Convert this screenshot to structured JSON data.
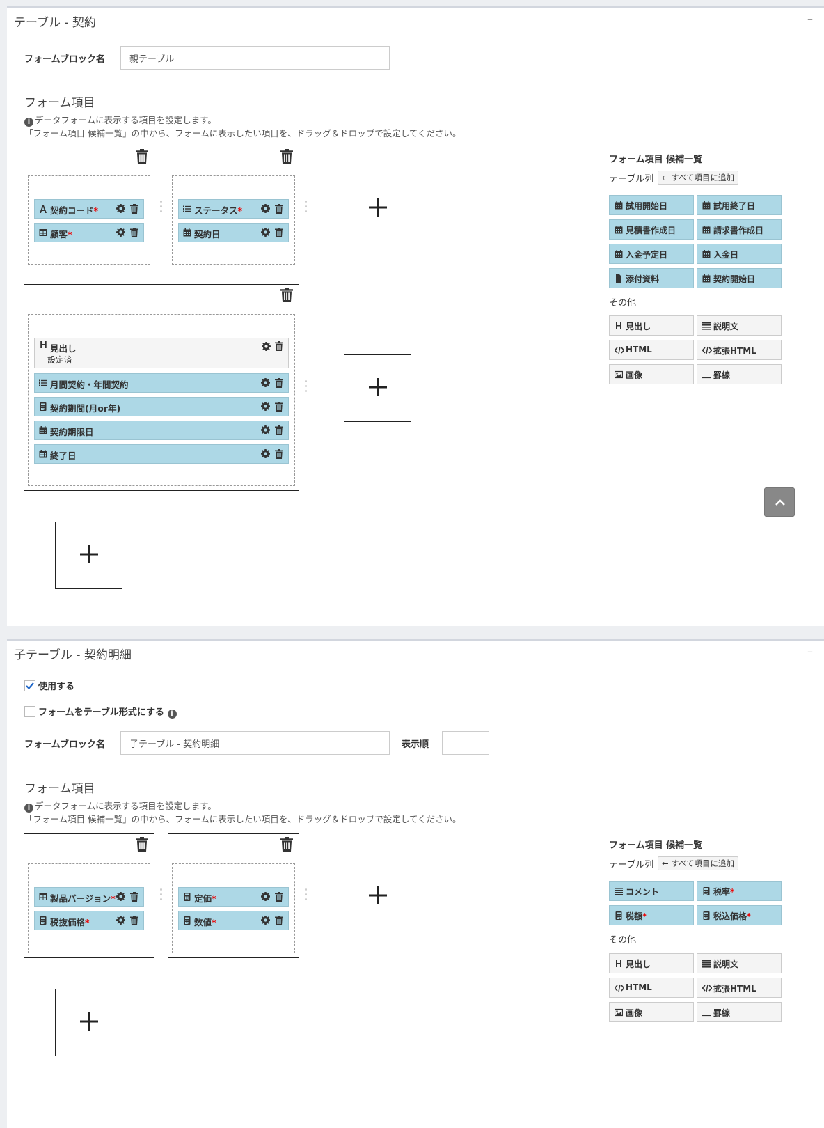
{
  "panel1": {
    "title": "テーブル - 契約",
    "collapse": "–",
    "block_name_label": "フォームブロック名",
    "block_name_value": "親テーブル",
    "section_title": "フォーム項目",
    "help_line1": "データフォームに表示する項目を設定します。",
    "help_line2": "「フォーム項目 候補一覧」の中から、フォームに表示したい項目を、ドラッグ＆ドロップで設定してください。",
    "blockA_items": [
      {
        "label": "契約コード",
        "req": "*",
        "icon": "text-icon"
      },
      {
        "label": "顧客",
        "req": "*",
        "icon": "table-icon"
      }
    ],
    "blockB_items": [
      {
        "label": "ステータス",
        "req": "*",
        "icon": "list-icon"
      },
      {
        "label": "契約日",
        "req": "",
        "icon": "calendar-icon"
      }
    ],
    "blockC_heading": {
      "label": "見出し",
      "sub": "設定済",
      "icon": "heading-icon"
    },
    "blockC_items": [
      {
        "label": "月間契約・年間契約",
        "req": "",
        "icon": "list-icon"
      },
      {
        "label": "契約期間(月or年)",
        "req": "",
        "icon": "calculator-icon"
      },
      {
        "label": "契約期限日",
        "req": "",
        "icon": "calendar-icon"
      },
      {
        "label": "終了日",
        "req": "",
        "icon": "calendar-icon"
      }
    ],
    "candidates_title": "フォーム項目 候補一覧",
    "table_col_label": "テーブル列",
    "add_all_label": "すべて項目に追加",
    "table_candidates": [
      {
        "label": "試用開始日",
        "req": "",
        "icon": "calendar-icon"
      },
      {
        "label": "試用終了日",
        "req": "",
        "icon": "calendar-icon"
      },
      {
        "label": "見積書作成日",
        "req": "",
        "icon": "calendar-icon"
      },
      {
        "label": "請求書作成日",
        "req": "",
        "icon": "calendar-icon"
      },
      {
        "label": "入金予定日",
        "req": "",
        "icon": "calendar-icon"
      },
      {
        "label": "入金日",
        "req": "",
        "icon": "calendar-icon"
      },
      {
        "label": "添付資料",
        "req": "",
        "icon": "file-icon"
      },
      {
        "label": "契約開始日",
        "req": "",
        "icon": "calendar-icon"
      }
    ],
    "other_label": "その他",
    "other_candidates": [
      {
        "label": "見出し",
        "icon": "heading-icon"
      },
      {
        "label": "説明文",
        "icon": "align-justify-icon"
      },
      {
        "label": "HTML",
        "icon": "code-icon"
      },
      {
        "label": "拡張HTML",
        "icon": "code-icon"
      },
      {
        "label": "画像",
        "icon": "image-icon"
      },
      {
        "label": "罫線",
        "icon": "horizontal-rule-icon"
      }
    ]
  },
  "panel2": {
    "title": "子テーブル - 契約明細",
    "collapse": "–",
    "use_label": "使用する",
    "use_checked": true,
    "table_format_label": "フォームをテーブル形式にする",
    "table_format_checked": false,
    "block_name_label": "フォームブロック名",
    "block_name_value": "子テーブル - 契約明細",
    "order_label": "表示順",
    "order_value": "",
    "section_title": "フォーム項目",
    "help_line1": "データフォームに表示する項目を設定します。",
    "help_line2": "「フォーム項目 候補一覧」の中から、フォームに表示したい項目を、ドラッグ＆ドロップで設定してください。",
    "blockA_items": [
      {
        "label": "製品バージョン",
        "req": "*",
        "icon": "table-icon"
      },
      {
        "label": "税抜価格",
        "req": "*",
        "icon": "calculator-icon"
      }
    ],
    "blockB_items": [
      {
        "label": "定価",
        "req": "*",
        "icon": "calculator-icon"
      },
      {
        "label": "数値",
        "req": "*",
        "icon": "calculator-icon"
      }
    ],
    "candidates_title": "フォーム項目 候補一覧",
    "table_col_label": "テーブル列",
    "add_all_label": "すべて項目に追加",
    "table_candidates": [
      {
        "label": "コメント",
        "req": "",
        "icon": "align-justify-icon"
      },
      {
        "label": "税率",
        "req": "*",
        "icon": "calculator-icon"
      },
      {
        "label": "税額",
        "req": "*",
        "icon": "calculator-icon"
      },
      {
        "label": "税込価格",
        "req": "*",
        "icon": "calculator-icon"
      }
    ],
    "other_label": "その他",
    "other_candidates": [
      {
        "label": "見出し",
        "icon": "heading-icon"
      },
      {
        "label": "説明文",
        "icon": "align-justify-icon"
      },
      {
        "label": "HTML",
        "icon": "code-icon"
      },
      {
        "label": "拡張HTML",
        "icon": "code-icon"
      },
      {
        "label": "画像",
        "icon": "image-icon"
      },
      {
        "label": "罫線",
        "icon": "horizontal-rule-icon"
      }
    ]
  },
  "colors": {
    "item_bg": "#add8e6",
    "required": "#ee0000",
    "candidate_gray": "#f4f4f4"
  }
}
